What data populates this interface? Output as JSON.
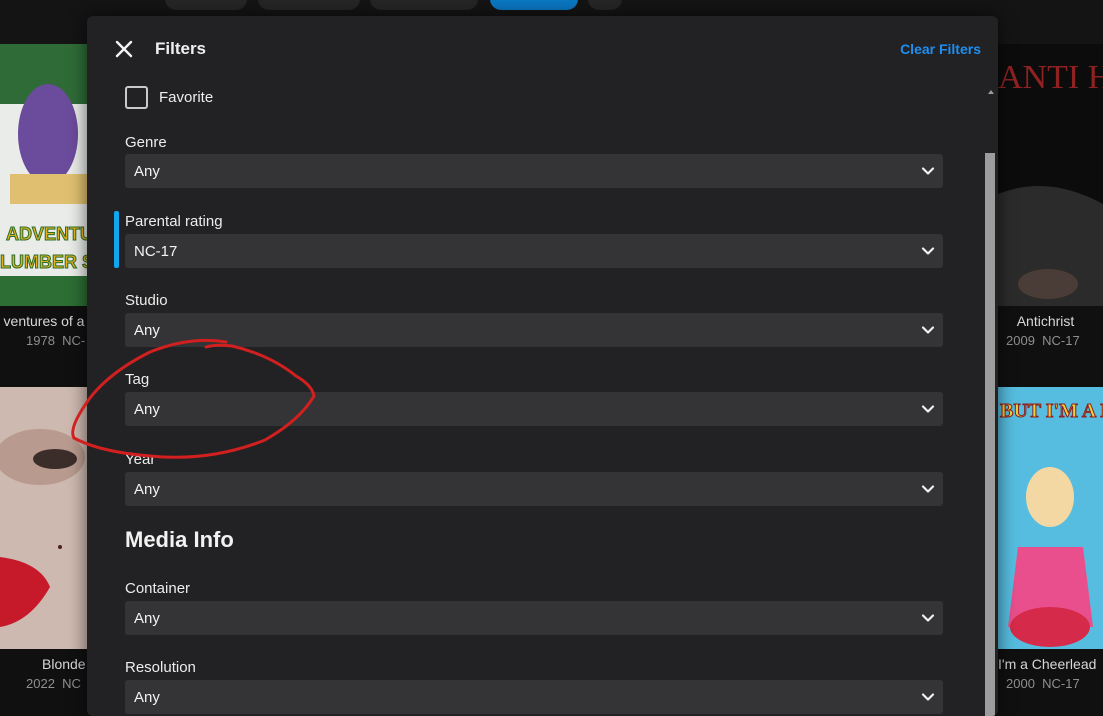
{
  "dialog": {
    "title": "Filters",
    "clear_label": "Clear Filters",
    "favorite_label": "Favorite",
    "section_media_info": "Media Info",
    "fields": [
      {
        "label": "Genre",
        "value": "Any"
      },
      {
        "label": "Parental rating",
        "value": "NC-17"
      },
      {
        "label": "Studio",
        "value": "Any"
      },
      {
        "label": "Tag",
        "value": "Any"
      },
      {
        "label": "Year",
        "value": "Any"
      },
      {
        "label": "Container",
        "value": "Any"
      },
      {
        "label": "Resolution",
        "value": "Any"
      }
    ]
  },
  "background": {
    "posters": [
      {
        "title": "ventures of a",
        "year": "1978",
        "rating": "NC-"
      },
      {
        "title": "Antichrist",
        "year": "2009",
        "rating": "NC-17"
      },
      {
        "title": "Blonde",
        "year": "2022",
        "rating": "NC"
      },
      {
        "title": "I'm a Cheerlead",
        "year": "2000",
        "rating": "NC-17"
      }
    ],
    "poster_texts": {
      "adventures": "ADVENTU",
      "adventures_sub": "LUMBER S",
      "antichrist": "ANTI HRIS",
      "cheerleader": "BUT I'M A EERLEADE"
    }
  },
  "colors": {
    "accent": "#12a5f0",
    "link": "#1e8ff0",
    "annotation": "#d21f1f"
  }
}
